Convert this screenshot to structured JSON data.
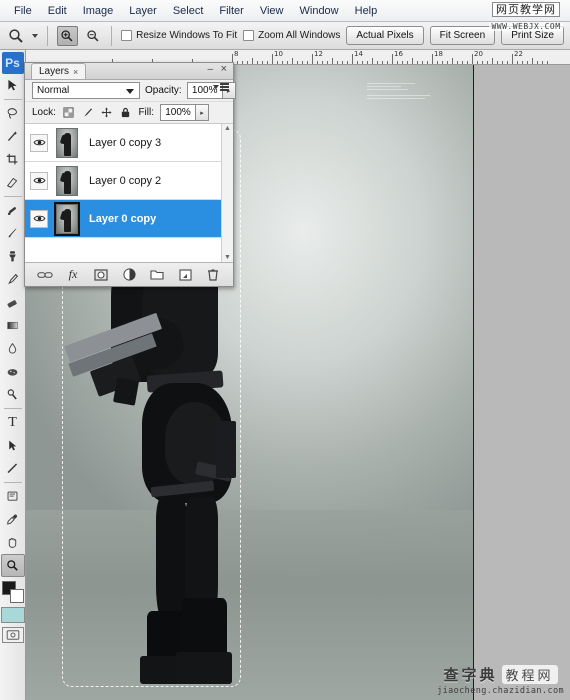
{
  "app": {
    "name": "Adobe Photoshop",
    "logo_text": "Ps"
  },
  "menubar": {
    "items": [
      {
        "label": "File"
      },
      {
        "label": "Edit"
      },
      {
        "label": "Image"
      },
      {
        "label": "Layer"
      },
      {
        "label": "Select"
      },
      {
        "label": "Filter"
      },
      {
        "label": "View"
      },
      {
        "label": "Window"
      },
      {
        "label": "Help"
      }
    ]
  },
  "watermark_top": {
    "chinese": "网页教学网",
    "url": "WWW.WEBJX.COM"
  },
  "watermark_bottom": {
    "brand_left": "查字典",
    "brand_right": "教程网",
    "url": "jiaocheng.chazidian.com"
  },
  "options_bar": {
    "active_tool": "zoom-tool",
    "zoom_in_label": "Zoom In",
    "zoom_out_label": "Zoom Out",
    "checkbox_resize_windows": {
      "label": "Resize Windows To Fit",
      "checked": false
    },
    "checkbox_zoom_all_windows": {
      "label": "Zoom All Windows",
      "checked": false
    },
    "buttons": [
      {
        "label": "Actual Pixels"
      },
      {
        "label": "Fit Screen"
      },
      {
        "label": "Print Size"
      }
    ]
  },
  "ruler": {
    "unit": "inches",
    "labels": [
      "8",
      "10",
      "12",
      "14",
      "16",
      "18",
      "20",
      "22"
    ]
  },
  "toolbox": {
    "tools": [
      {
        "name": "move-tool",
        "selected": false
      },
      {
        "name": "lasso-tool",
        "selected": false
      },
      {
        "name": "magic-wand-tool",
        "selected": false
      },
      {
        "name": "crop-tool",
        "selected": false
      },
      {
        "name": "slice-tool",
        "selected": false
      },
      {
        "name": "healing-brush-tool",
        "selected": false
      },
      {
        "name": "brush-tool",
        "selected": false
      },
      {
        "name": "clone-stamp-tool",
        "selected": false
      },
      {
        "name": "history-brush-tool",
        "selected": false
      },
      {
        "name": "eraser-tool",
        "selected": false
      },
      {
        "name": "gradient-tool",
        "selected": false
      },
      {
        "name": "blur-tool",
        "selected": false
      },
      {
        "name": "dodge-tool",
        "selected": false
      },
      {
        "name": "pen-tool",
        "selected": false
      },
      {
        "name": "type-tool",
        "selected": false
      },
      {
        "name": "path-selection-tool",
        "selected": false
      },
      {
        "name": "line-tool",
        "selected": false
      },
      {
        "name": "notes-tool",
        "selected": false
      },
      {
        "name": "eyedropper-tool",
        "selected": false
      },
      {
        "name": "hand-tool",
        "selected": false
      },
      {
        "name": "zoom-tool",
        "selected": true
      }
    ],
    "foreground_color": "#1a1a1a",
    "background_color": "#ffffff",
    "quick_mask_color": "#a8d8d8",
    "type_tool_glyph": "T"
  },
  "layers_panel": {
    "tab_label": "Layers",
    "close_glyph": "×",
    "minimize_glyph": "–",
    "window_close_glyph": "×",
    "blend_mode": "Normal",
    "opacity_label": "Opacity:",
    "opacity_value": "100%",
    "fill_label": "Fill:",
    "fill_value": "100%",
    "lock_label": "Lock:",
    "lock_icons": [
      "lock-transparent-pixels-icon",
      "lock-image-pixels-icon",
      "lock-position-icon",
      "lock-all-icon"
    ],
    "layers": [
      {
        "name": "Layer 0 copy 3",
        "visible": true,
        "selected": false
      },
      {
        "name": "Layer 0 copy 2",
        "visible": true,
        "selected": false
      },
      {
        "name": "Layer 0 copy",
        "visible": true,
        "selected": true
      }
    ],
    "bottom_icons": [
      {
        "name": "link-layers-icon"
      },
      {
        "name": "layer-style-fx-icon",
        "glyph": "fx"
      },
      {
        "name": "add-layer-mask-icon"
      },
      {
        "name": "new-adjustment-layer-icon"
      },
      {
        "name": "new-group-icon"
      },
      {
        "name": "new-layer-icon"
      },
      {
        "name": "delete-layer-icon"
      }
    ]
  },
  "canvas": {
    "document_background": "#b9b9b9",
    "selection_active": true,
    "selection_style": "marching-ants",
    "photo_subject": "woman in black leather outfit holding a firearm, rear three-quarter view, studio grey backdrop"
  }
}
